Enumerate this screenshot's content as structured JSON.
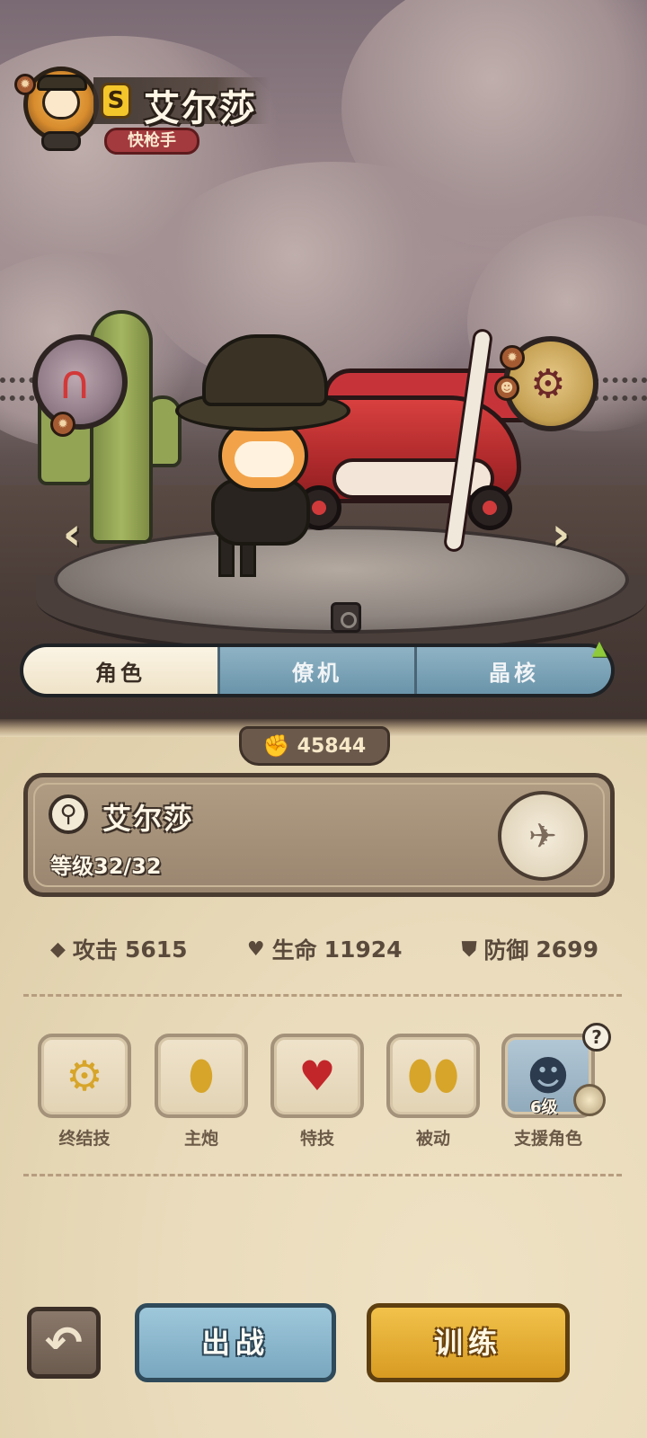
{
  "header": {
    "rank": "S",
    "hero_name": "艾尔莎",
    "class_tag": "快枪手"
  },
  "scene": {
    "left_orb_icon": "magnet-icon",
    "right_orb_icon": "machine-gun-icon",
    "prev_arrow": "‹",
    "next_arrow": "›"
  },
  "tabs": [
    {
      "label": "角色",
      "active": true
    },
    {
      "label": "僚机",
      "active": false
    },
    {
      "label": "晶核",
      "active": false
    }
  ],
  "currency": {
    "value": "45844",
    "icon": "fist-coin-icon"
  },
  "info_card": {
    "name": "艾尔莎",
    "level": "等级32/32"
  },
  "stats": [
    {
      "icon": "bullet-icon",
      "label": "攻击",
      "value": "5615"
    },
    {
      "icon": "heart-icon",
      "label": "生命",
      "value": "11924"
    },
    {
      "icon": "shield-icon",
      "label": "防御",
      "value": "2699"
    }
  ],
  "skills": [
    {
      "label": "终结技",
      "icon": "gatling-icon"
    },
    {
      "label": "主炮",
      "icon": "bullet-icon"
    },
    {
      "label": "特技",
      "icon": "heart-gem-icon"
    },
    {
      "label": "被动",
      "icon": "double-bullet-icon"
    },
    {
      "label": "支援角色",
      "icon": "penguin-pilot-icon",
      "level": "6级"
    }
  ],
  "buttons": {
    "back": "↶",
    "fight": "出战",
    "train": "训练"
  },
  "colors": {
    "tab_active": "#efe3c8",
    "tab_inactive": "#79a0b5",
    "fight_button": "#8fbcd1",
    "train_button": "#e6ae34",
    "class_tag": "#a33a3e",
    "rank_badge": "#f4c62b"
  }
}
